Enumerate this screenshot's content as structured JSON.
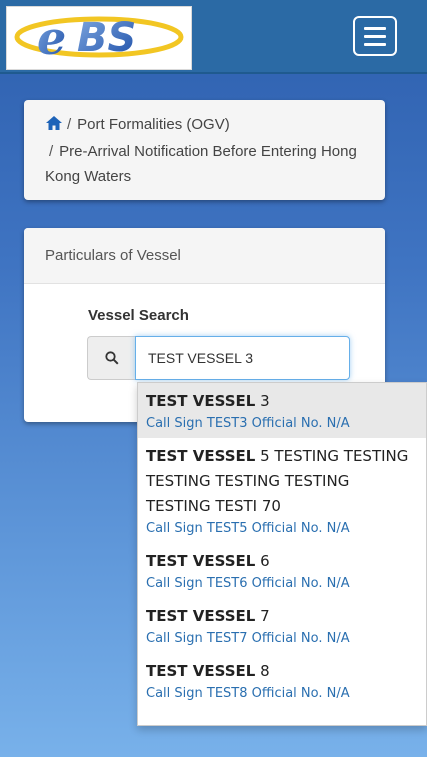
{
  "header": {
    "logo_text": "eBS",
    "menu_icon": "hamburger-icon"
  },
  "breadcrumb": {
    "home_icon": "home-icon",
    "items": [
      "Port Formalities (OGV)",
      "Pre-Arrival Notification Before Entering Hong Kong Waters"
    ]
  },
  "panel": {
    "title": "Particulars of Vessel",
    "search_label": "Vessel Search",
    "search_icon": "search-icon",
    "search_value": "TEST VESSEL 3"
  },
  "suggestions": [
    {
      "name_bold": "TEST VESSEL",
      "name_rest": " 3",
      "sub": "Call Sign TEST3 Official No. N/A"
    },
    {
      "name_bold": "TEST VESSEL",
      "name_rest": " 5 TESTING TESTING TESTING TESTING TESTING TESTING TESTI 70",
      "sub": "Call Sign TEST5 Official No. N/A"
    },
    {
      "name_bold": "TEST VESSEL",
      "name_rest": " 6",
      "sub": "Call Sign TEST6 Official No. N/A"
    },
    {
      "name_bold": "TEST VESSEL",
      "name_rest": " 7",
      "sub": "Call Sign TEST7 Official No. N/A"
    },
    {
      "name_bold": "TEST VESSEL",
      "name_rest": " 8",
      "sub": "Call Sign TEST8 Official No. N/A"
    }
  ],
  "colors": {
    "topbar": "#2b6aa5",
    "link_blue": "#2a6fb0"
  }
}
